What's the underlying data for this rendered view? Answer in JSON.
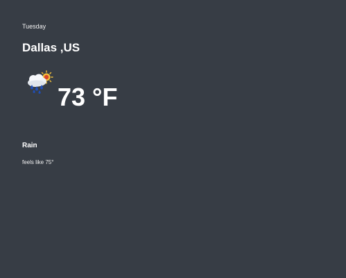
{
  "weather": {
    "day": "Tuesday",
    "city": "Dallas ,US",
    "temperature": "73 °F",
    "condition": "Rain",
    "feels_like": "feels like 75°",
    "icon": "rain-cloud-sun-icon"
  },
  "colors": {
    "background": "#373d45",
    "text": "#ffffff",
    "sun": "#f5c23a",
    "sun_core": "#d9462b",
    "rain": "#1f4fb8"
  }
}
